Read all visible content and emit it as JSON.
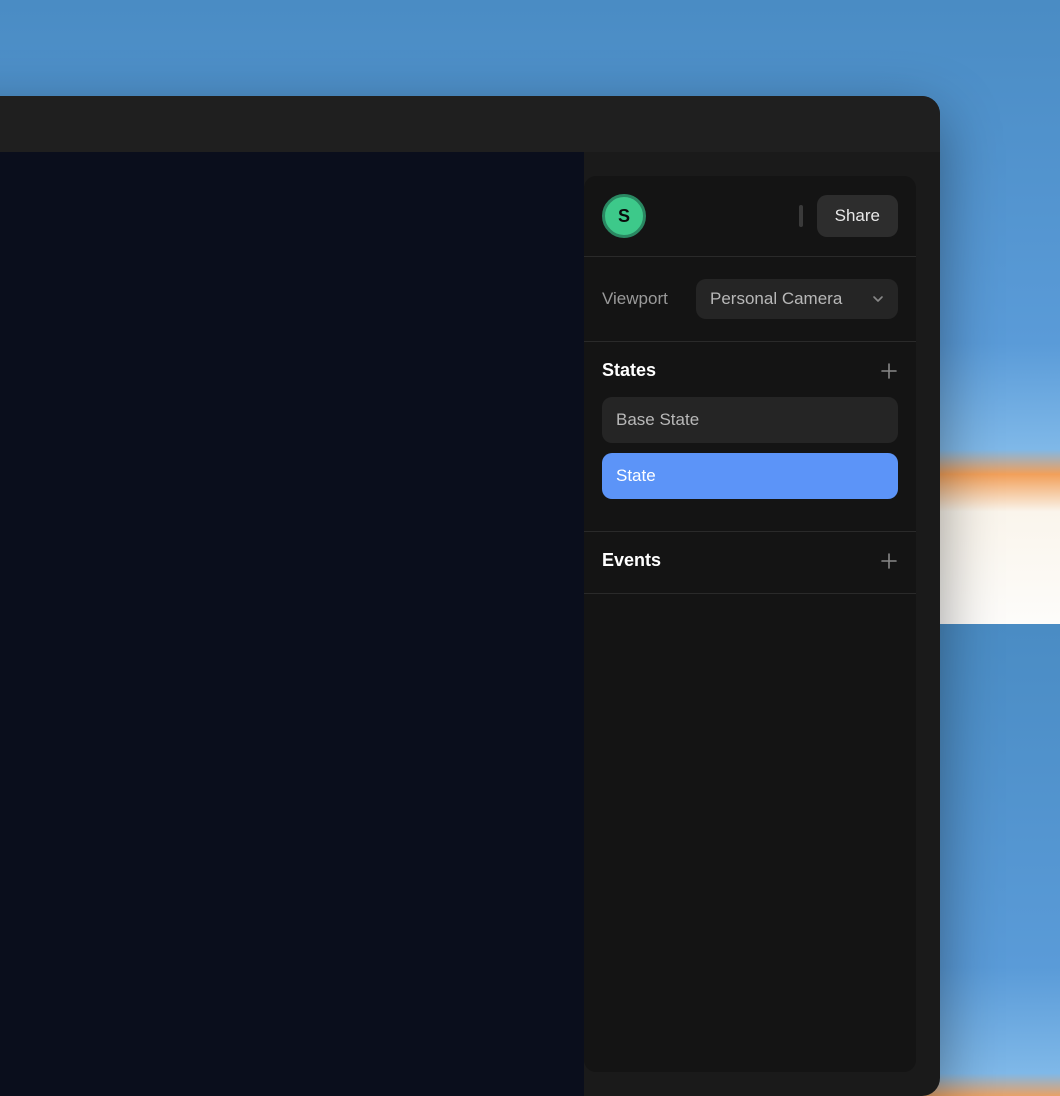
{
  "header": {
    "avatar_initial": "S",
    "share_label": "Share"
  },
  "viewport": {
    "label": "Viewport",
    "selected": "Personal Camera"
  },
  "states": {
    "title": "States",
    "items": [
      {
        "label": "Base State",
        "active": false
      },
      {
        "label": "State",
        "active": true
      }
    ]
  },
  "events": {
    "title": "Events"
  }
}
